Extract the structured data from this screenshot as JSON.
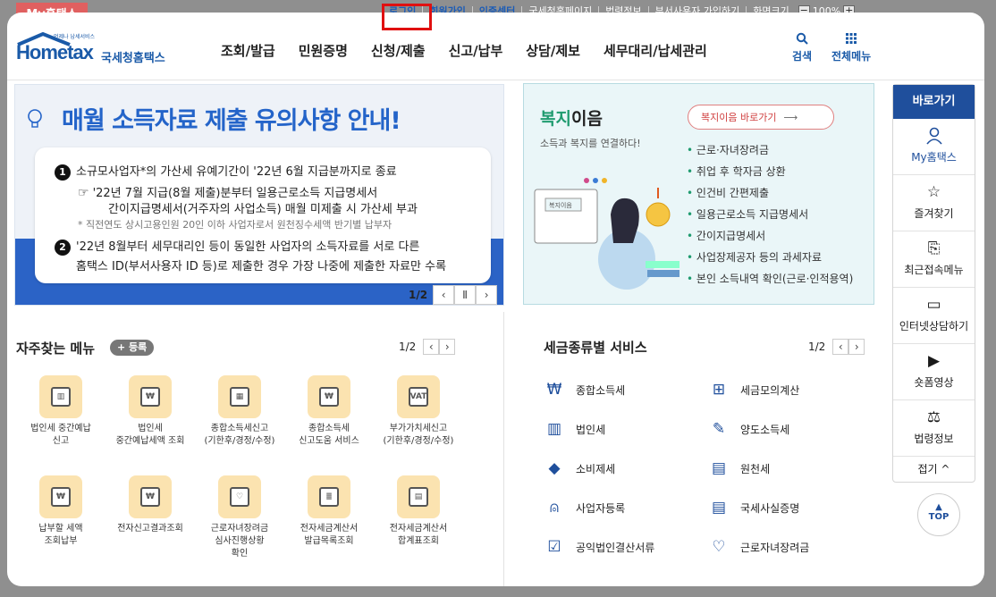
{
  "topbar": {
    "myhometax_tab": "My홈택스",
    "links": [
      "로그인",
      "회원가입",
      "인증센터",
      "국세청홈페이지",
      "법령정보",
      "부서사용자 가입하기",
      "화면크기"
    ],
    "zoom_minus": "−",
    "zoom_value": "100%",
    "zoom_plus": "+"
  },
  "header": {
    "logo_word": "Hometax",
    "logo_sub": "국세청홈택스",
    "logo_tiny": "언제나 납세서비스",
    "nav": [
      "조회/발급",
      "민원증명",
      "신청/제출",
      "신고/납부",
      "상담/제보",
      "세무대리/납세관리"
    ],
    "search_label": "검색",
    "all_menu_label": "전체메뉴"
  },
  "banner": {
    "title": "매월 소득자료 제출 유의사항 안내!",
    "line1": "소규모사업자*의 가산세 유예기간이 '22년 6월 지급분까지로 종료",
    "line1a": "'22년 7월 지급(8월 제출)분부터 일용근로소득 지급명세서",
    "line1b": "간이지급명세서(거주자의 사업소득) 매월 미제출 시 가산세 부과",
    "line1c": "* 직전연도 상시고용인원 20인 이하 사업자로서 원천징수세액 반기별 납부자",
    "line2a": "'22년 8월부터 세무대리인 등이 동일한 사업자의 소득자료를 서로 다른",
    "line2b": "홈택스 ID(부서사용자 ID 등)로 제출한 경우 가장 나중에 제출한 자료만 수록",
    "num1": "1",
    "num2": "2",
    "page": "1/2"
  },
  "welfare": {
    "title_green": "복지",
    "title_rest": "이음",
    "desc": "소득과 복지를 연결하다!",
    "button": "복지이음 바로가기",
    "illust_card": "복지이음",
    "items": [
      "근로·자녀장려금",
      "취업 후 학자금 상환",
      "인건비 간편제출",
      "일용근로소득 지급명세서",
      "간이지급명세서",
      "사업장제공자 등의 과세자료",
      "본인 소득내역 확인(근로·인적용역)"
    ]
  },
  "quick": {
    "title": "바로가기",
    "items": [
      "My홈택스",
      "즐겨찾기",
      "최근접속메뉴",
      "인터넷상담하기",
      "숏폼영상",
      "법령정보"
    ],
    "fold": "접기 ^",
    "top": "TOP"
  },
  "freq": {
    "title": "자주찾는 메뉴",
    "register": "+ 등록",
    "page": "1/2",
    "items": [
      "법인세 중간예납\n신고",
      "법인세\n중간예납세액 조회",
      "종합소득세신고\n(기한후/경정/수정)",
      "종합소득세\n신고도움 서비스",
      "부가가치세신고\n(기한후/경정/수정)",
      "납부할 세액\n조회납부",
      "전자신고결과조회",
      "근로자녀장려금\n심사진행상황\n확인",
      "전자세금계산서\n발급목록조회",
      "전자세금계산서\n합계표조회"
    ]
  },
  "taxtype": {
    "title": "세금종류별 서비스",
    "page": "1/2",
    "items": [
      "종합소득세",
      "세금모의계산",
      "법인세",
      "양도소득세",
      "소비제세",
      "원천세",
      "사업자등록",
      "국세사실증명",
      "공익법인결산서류",
      "근로자녀장려금"
    ]
  }
}
